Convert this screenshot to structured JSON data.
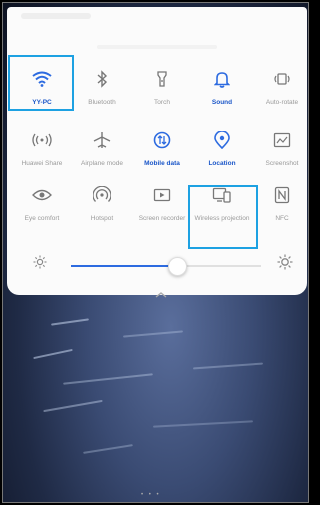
{
  "quick_settings": {
    "row1": [
      {
        "label": "YY-PC",
        "icon": "wifi-icon",
        "active": true
      },
      {
        "label": "Bluetooth",
        "icon": "bluetooth-icon",
        "active": false
      },
      {
        "label": "Torch",
        "icon": "torch-icon",
        "active": false
      },
      {
        "label": "Sound",
        "icon": "bell-icon",
        "active": true
      },
      {
        "label": "Auto-rotate",
        "icon": "auto-rotate-icon",
        "active": false
      }
    ],
    "row2": [
      {
        "label": "Huawei Share",
        "icon": "huawei-share-icon",
        "active": false
      },
      {
        "label": "Airplane mode",
        "icon": "airplane-icon",
        "active": false
      },
      {
        "label": "Mobile data",
        "icon": "mobile-data-icon",
        "active": true
      },
      {
        "label": "Location",
        "icon": "location-icon",
        "active": true
      },
      {
        "label": "Screenshot",
        "icon": "screenshot-icon",
        "active": false
      }
    ],
    "row3": [
      {
        "label": "Eye comfort",
        "icon": "eye-icon",
        "active": false
      },
      {
        "label": "Hotspot",
        "icon": "hotspot-icon",
        "active": false
      },
      {
        "label": "Screen recorder",
        "icon": "screen-recorder-icon",
        "active": false
      },
      {
        "label": "Wireless projection",
        "icon": "wireless-projection-icon",
        "active": false
      },
      {
        "label": "NFC",
        "icon": "nfc-icon",
        "active": false
      }
    ],
    "brightness": {
      "level_fraction": 0.55,
      "low_icon": "brightness-low-icon",
      "high_icon": "brightness-high-icon"
    }
  },
  "colors": {
    "active": "#1a56c8",
    "inactive": "#8a8a8a",
    "highlight": "#1da1e2"
  }
}
